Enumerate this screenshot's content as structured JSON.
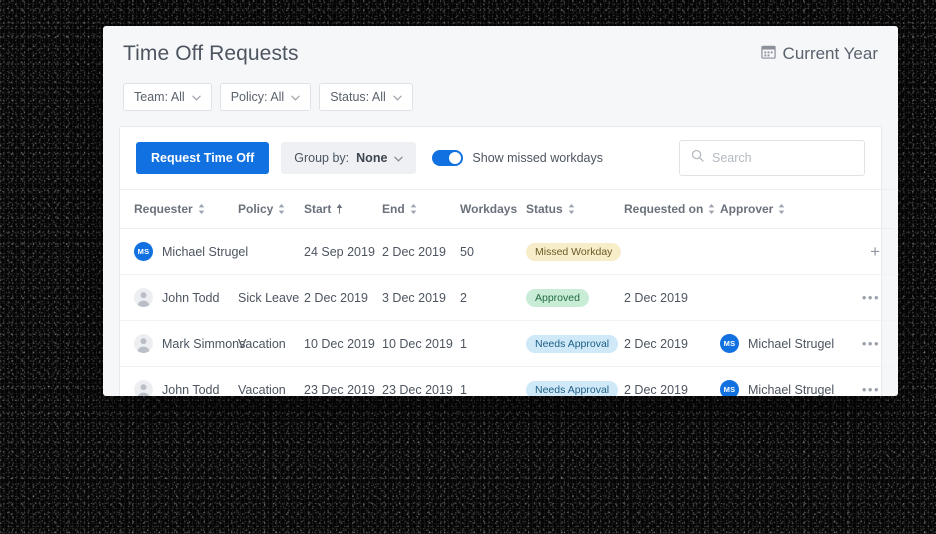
{
  "header": {
    "title": "Time Off Requests",
    "date_range_label": "Current Year",
    "calendar_icon": "calendar-icon"
  },
  "filters": [
    {
      "label": "Team: All",
      "name": "team"
    },
    {
      "label": "Policy: All",
      "name": "policy"
    },
    {
      "label": "Status: All",
      "name": "status"
    }
  ],
  "toolbar": {
    "request_button": "Request Time Off",
    "group_by_prefix": "Group by:",
    "group_by_value": "None",
    "toggle_label": "Show missed workdays",
    "toggle_on": true,
    "search_placeholder": "Search",
    "search_value": "",
    "search_icon": "search-icon"
  },
  "table": {
    "columns": [
      {
        "label": "Requester",
        "sort": "both"
      },
      {
        "label": "Policy",
        "sort": "both"
      },
      {
        "label": "Start",
        "sort": "asc"
      },
      {
        "label": "End",
        "sort": "both"
      },
      {
        "label": "Workdays",
        "sort": "none"
      },
      {
        "label": "Status",
        "sort": "both"
      },
      {
        "label": "Requested on",
        "sort": "both"
      },
      {
        "label": "Approver",
        "sort": "both"
      }
    ],
    "rows": [
      {
        "requester": "Michael Strugel",
        "requester_avatar": "MS",
        "policy": "",
        "start": "24 Sep 2019",
        "end": "2 Dec 2019",
        "workdays": "50",
        "status": "Missed Workday",
        "status_kind": "missed",
        "requested_on": "",
        "approver": "",
        "approver_avatar": "",
        "action": "plus"
      },
      {
        "requester": "John Todd",
        "requester_avatar": "",
        "policy": "Sick Leave",
        "start": "2 Dec 2019",
        "end": "3 Dec 2019",
        "workdays": "2",
        "status": "Approved",
        "status_kind": "approved",
        "requested_on": "2 Dec 2019",
        "approver": "",
        "approver_avatar": "",
        "action": "dots"
      },
      {
        "requester": "Mark Simmons",
        "requester_avatar": "",
        "policy": "Vacation",
        "start": "10 Dec 2019",
        "end": "10 Dec 2019",
        "workdays": "1",
        "status": "Needs Approval",
        "status_kind": "needs",
        "requested_on": "2 Dec 2019",
        "approver": "Michael Strugel",
        "approver_avatar": "MS",
        "action": "dots"
      },
      {
        "requester": "John Todd",
        "requester_avatar": "",
        "policy": "Vacation",
        "start": "23 Dec 2019",
        "end": "23 Dec 2019",
        "workdays": "1",
        "status": "Needs Approval",
        "status_kind": "needs",
        "requested_on": "2 Dec 2019",
        "approver": "Michael Strugel",
        "approver_avatar": "MS",
        "action": "dots"
      }
    ]
  },
  "colors": {
    "accent": "#1271e0",
    "badge_missed_bg": "#f7eec9",
    "badge_approved_bg": "#c9ecd7",
    "badge_needs_bg": "#cfe9f9"
  }
}
